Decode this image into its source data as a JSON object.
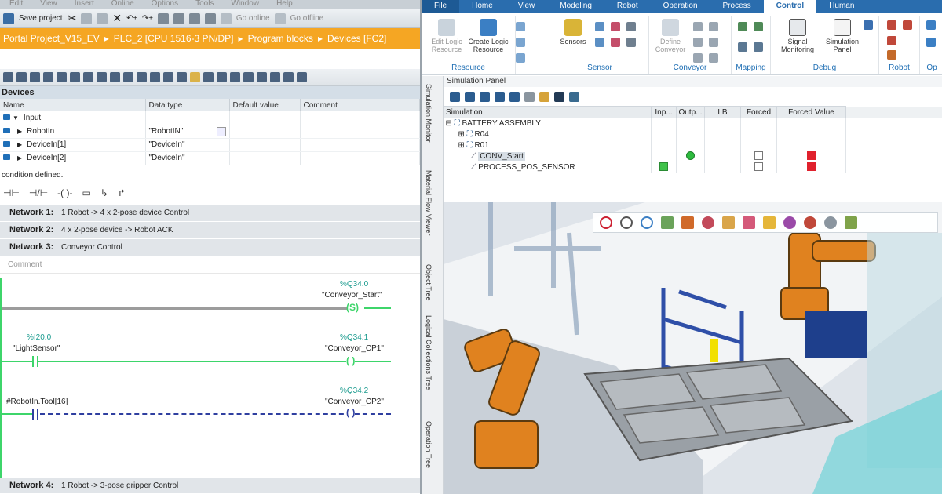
{
  "left": {
    "menu": [
      "Edit",
      "View",
      "Insert",
      "Online",
      "Options",
      "Tools",
      "Window",
      "Help"
    ],
    "toolbar": {
      "save_label": "Save project",
      "go_online": "Go online",
      "go_offline": "Go offline"
    },
    "breadcrumb": [
      "Portal Project_V15_EV",
      "PLC_2 [CPU 1516-3 PN/DP]",
      "Program blocks",
      "Devices [FC2]"
    ],
    "interface": {
      "title": "Devices",
      "columns": [
        "Name",
        "Data type",
        "Default value",
        "Comment"
      ],
      "rows": [
        {
          "name": "Input",
          "type": "",
          "section": true
        },
        {
          "name": "RobotIn",
          "type": "\"RobotIN\""
        },
        {
          "name": "DeviceIn[1]",
          "type": "\"DeviceIn\""
        },
        {
          "name": "DeviceIn[2]",
          "type": "\"DeviceIn\""
        }
      ]
    },
    "condition_text": "condition defined.",
    "networks": [
      {
        "label": "Network 1:",
        "title": "1 Robot -> 4 x 2-pose device Control"
      },
      {
        "label": "Network 2:",
        "title": "4 x 2-pose device -> Robot ACK"
      },
      {
        "label": "Network 3:",
        "title": "Conveyor Control"
      }
    ],
    "comment_placeholder": "Comment",
    "ladder": {
      "r1_addr": "%Q34.0",
      "r1_tag": "\"Conveyor_Start\"",
      "r2_in_addr": "%I20.0",
      "r2_in_tag": "\"LightSensor\"",
      "r2_addr": "%Q34.1",
      "r2_tag": "\"Conveyor_CP1\"",
      "r3_in_tag": "#RobotIn.Tool[16]",
      "r3_addr": "%Q34.2",
      "r3_tag": "\"Conveyor_CP2\""
    },
    "network4": {
      "label": "Network 4:",
      "title": "1 Robot -> 3-pose gripper Control"
    }
  },
  "right": {
    "tabs": [
      "File",
      "Home",
      "View",
      "Modeling",
      "Robot",
      "Operation",
      "Process",
      "Control",
      "Human"
    ],
    "active_tab": "Control",
    "ribbon": {
      "edit_logic": "Edit Logic Resource",
      "create_logic": "Create Logic Resource",
      "resource_group": "Resource",
      "sensors": "Sensors",
      "sensor_group": "Sensor",
      "define_conveyor": "Define Conveyor",
      "conveyor_group": "Conveyor",
      "mapping_group": "Mapping",
      "signal_monitoring": "Signal Monitoring",
      "simulation_panel": "Simulation Panel",
      "debug_group": "Debug",
      "robot_group": "Robot",
      "op_group": "Op"
    },
    "side_tabs": [
      "Simulation Monitor",
      "Material Flow Viewer",
      "Object Tree",
      "Logical Collections Tree",
      "Operation Tree"
    ],
    "sim_panel": {
      "title": "Simulation Panel",
      "columns": [
        "Simulation",
        "Inp...",
        "Outp...",
        "LB",
        "Forced",
        "Forced Value"
      ],
      "rows": [
        {
          "name": "BATTERY ASSEMBLY",
          "level": 0
        },
        {
          "name": "R04",
          "level": 1
        },
        {
          "name": "R01",
          "level": 1
        },
        {
          "name": "CONV_Start",
          "level": 2
        },
        {
          "name": "PROCESS_POS_SENSOR",
          "level": 2
        }
      ]
    }
  }
}
